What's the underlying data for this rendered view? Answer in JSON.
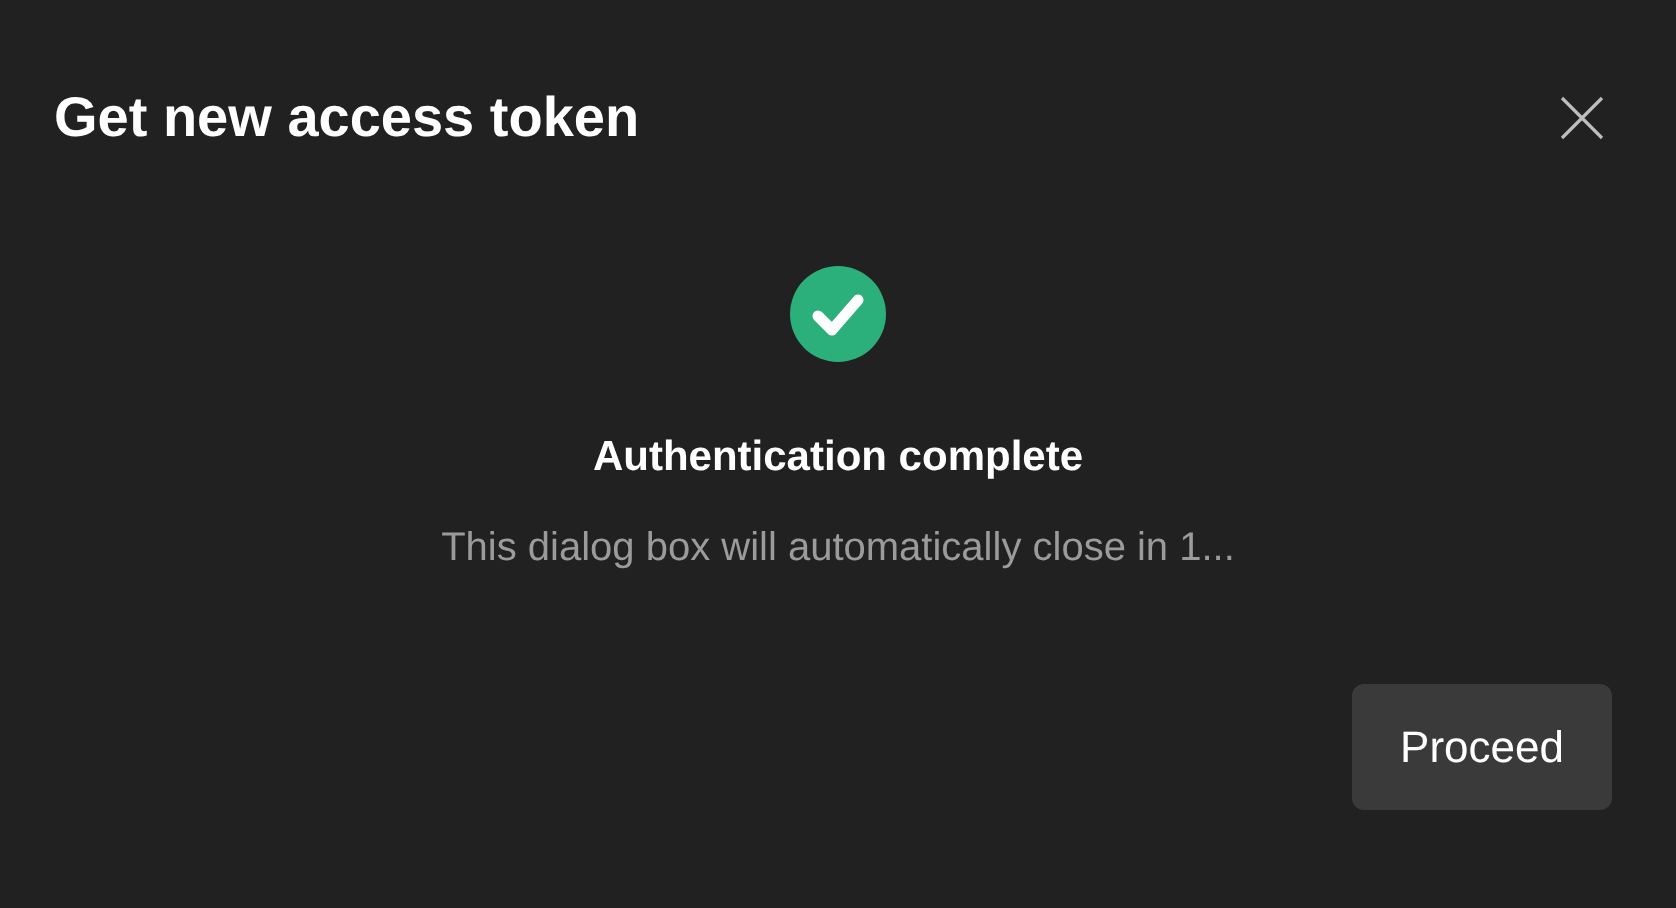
{
  "dialog": {
    "title": "Get new access token",
    "status": {
      "heading": "Authentication complete",
      "message": "This dialog box will automatically close in 1..."
    },
    "buttons": [
      "Proceed"
    ]
  }
}
